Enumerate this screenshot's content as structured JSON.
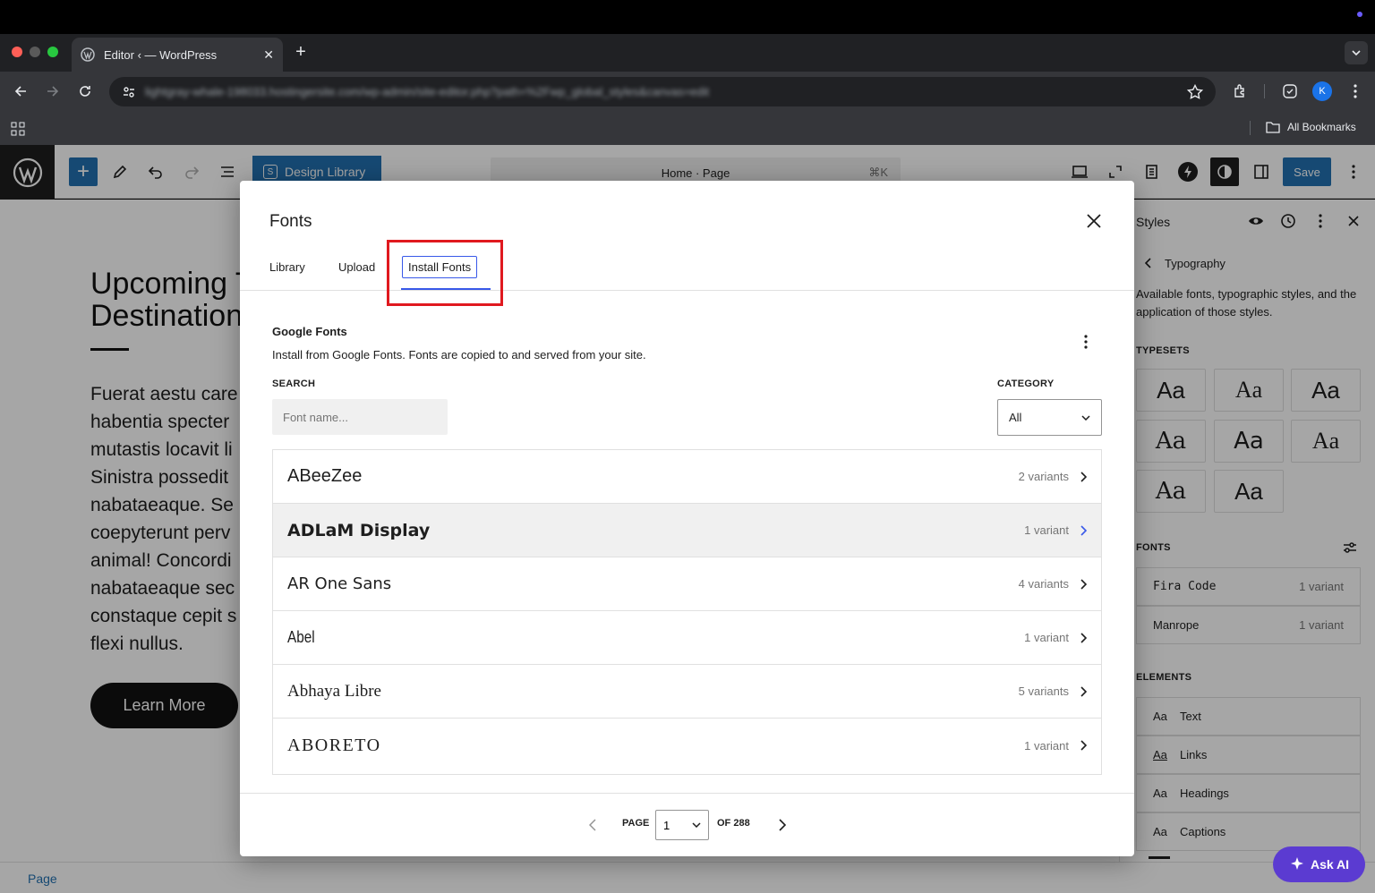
{
  "browser": {
    "tab_title": "Editor ‹ — WordPress",
    "url": "lightgray-whale-198033.hostingersite.com/wp-admin/site-editor.php?path=%2Fwp_global_styles&canvas=edit",
    "profile_initial": "K",
    "bookmarks_label": "All Bookmarks"
  },
  "toolbar": {
    "design_library_label": "Design Library",
    "command_title": "Home · Page",
    "command_shortcut": "⌘K",
    "save_label": "Save"
  },
  "page": {
    "heading_line1": "Upcoming T",
    "heading_line2": "Destination",
    "paragraph_lines": [
      "Fuerat aestu care",
      "habentia specter",
      "mutastis locavit li",
      "Sinistra possedit",
      "nabataeaque. Se",
      "coepyterunt perv",
      "animal! Concordi",
      "nabataeaque sec",
      "constaque cepit s",
      "flexi nullus."
    ],
    "learn_more_label": "Learn More",
    "footer_label": "Page"
  },
  "sidebar": {
    "title": "Styles",
    "back_title": "Typography",
    "description": "Available fonts, typographic styles, and the application of those styles.",
    "typesets_heading": "TYPESETS",
    "typeset_sample": "Aa",
    "fonts_heading": "FONTS",
    "fonts": [
      {
        "name": "Fira Code",
        "variants": "1 variant"
      },
      {
        "name": "Manrope",
        "variants": "1 variant"
      }
    ],
    "elements_heading": "ELEMENTS",
    "elements": [
      {
        "sample": "Aa",
        "label": "Text"
      },
      {
        "sample": "Aa",
        "label": "Links"
      },
      {
        "sample": "Aa",
        "label": "Headings"
      },
      {
        "sample": "Aa",
        "label": "Captions"
      }
    ]
  },
  "modal": {
    "title": "Fonts",
    "tabs": [
      "Library",
      "Upload",
      "Install Fonts"
    ],
    "section_title": "Google Fonts",
    "section_desc": "Install from Google Fonts. Fonts are copied to and served from your site.",
    "search_label": "SEARCH",
    "search_placeholder": "Font name...",
    "category_label": "CATEGORY",
    "category_value": "All",
    "fonts": [
      {
        "name": "ABeeZee",
        "variants": "2 variants"
      },
      {
        "name": "ADLaM Display",
        "variants": "1 variant"
      },
      {
        "name": "AR One Sans",
        "variants": "4 variants"
      },
      {
        "name": "Abel",
        "variants": "1 variant"
      },
      {
        "name": "Abhaya Libre",
        "variants": "5 variants"
      },
      {
        "name": "ABORETO",
        "variants": "1 variant"
      }
    ],
    "pagination": {
      "page_label": "PAGE",
      "current": "1",
      "of_label": "OF 288"
    }
  },
  "ask_ai_label": "Ask AI",
  "colors": {
    "accent": "#3858e9",
    "save": "#2271b1",
    "highlight": "#e0191f",
    "ask_ai": "#5b3bd1"
  }
}
